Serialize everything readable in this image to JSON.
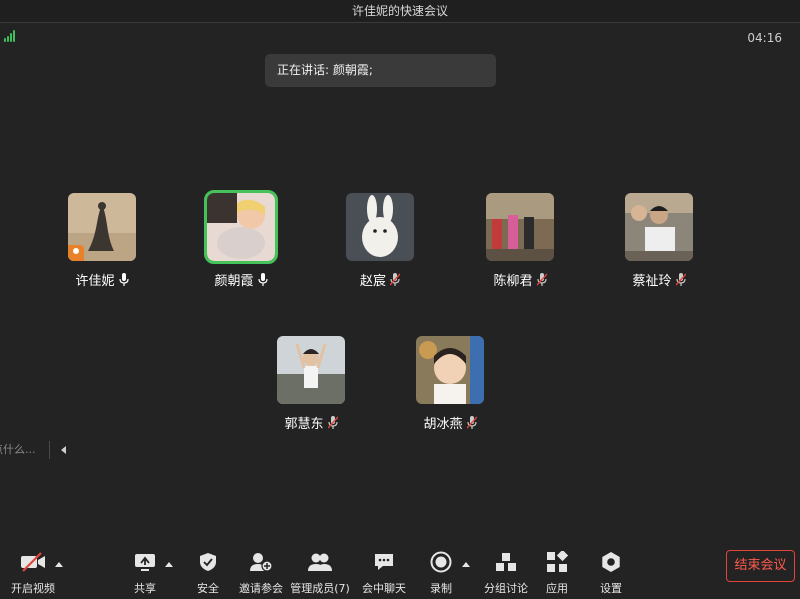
{
  "window": {
    "title": "许佳妮的快速会议"
  },
  "status": {
    "timer": "04:16",
    "speaking_label": "正在讲话: 颜朝霞;"
  },
  "participants": [
    {
      "name": "许佳妮",
      "mic": "on",
      "host": true,
      "active": false
    },
    {
      "name": "颜朝霞",
      "mic": "on",
      "host": false,
      "active": true
    },
    {
      "name": "赵宸",
      "mic": "muted",
      "host": false,
      "active": false
    },
    {
      "name": "陈柳君",
      "mic": "muted",
      "host": false,
      "active": false
    },
    {
      "name": "蔡祉玲",
      "mic": "muted",
      "host": false,
      "active": false
    },
    {
      "name": "郭慧东",
      "mic": "muted",
      "host": false,
      "active": false
    },
    {
      "name": "胡冰燕",
      "mic": "muted",
      "host": false,
      "active": false
    }
  ],
  "side_chat": {
    "placeholder_fragment": "点什么..."
  },
  "toolbar": {
    "video": "开启视频",
    "share": "共享",
    "security": "安全",
    "invite": "邀请参会",
    "members": "管理成员(7)",
    "chat": "会中聊天",
    "record": "录制",
    "breakout": "分组讨论",
    "apps": "应用",
    "settings": "设置",
    "end": "结束会议"
  },
  "colors": {
    "active_speaker": "#46c25a",
    "end_button": "#e0463b",
    "signal": "#3fbf5a"
  }
}
